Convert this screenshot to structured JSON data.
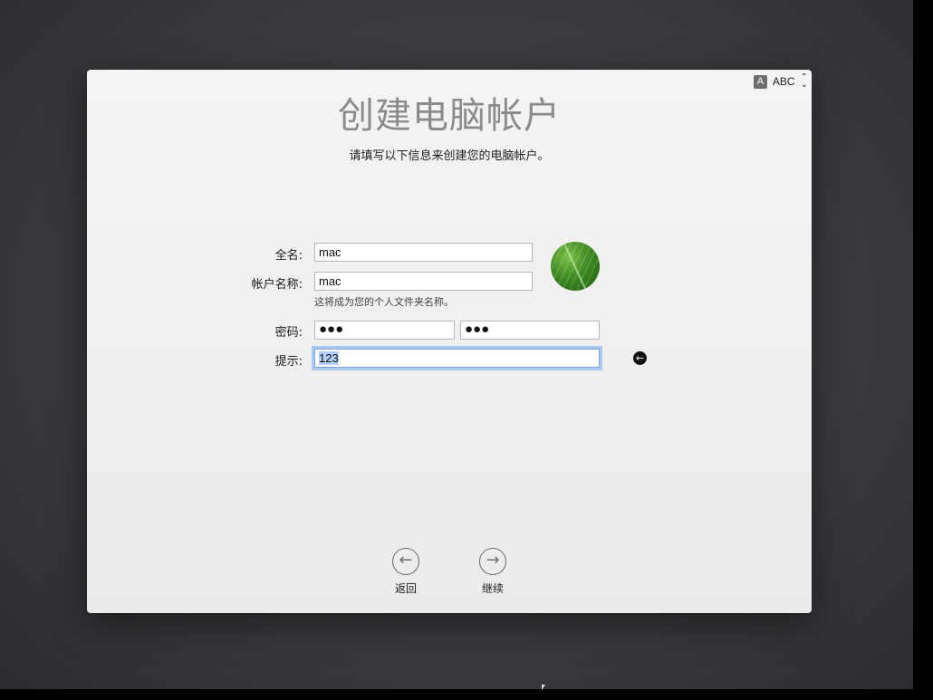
{
  "window": {
    "title": "创建电脑帐户",
    "subtitle": "请填写以下信息来创建您的电脑帐户。"
  },
  "input_menu": {
    "badge": "A",
    "source": "ABC"
  },
  "form": {
    "full_name_label": "全名:",
    "full_name_value": "mac",
    "account_name_label": "帐户名称:",
    "account_name_value": "mac",
    "account_name_caption": "这将成为您的个人文件夹名称。",
    "password_label": "密码:",
    "password_value": "●●●",
    "verify_value": "●●●",
    "hint_label": "提示:",
    "hint_value": "123"
  },
  "nav": {
    "back_label": "返回",
    "continue_label": "继续"
  },
  "icons": {
    "back": "arrow-left-circle-icon",
    "continue": "arrow-right-circle-icon",
    "hint_go": "arrow-left-filled-icon",
    "avatar": "leaf-avatar"
  }
}
